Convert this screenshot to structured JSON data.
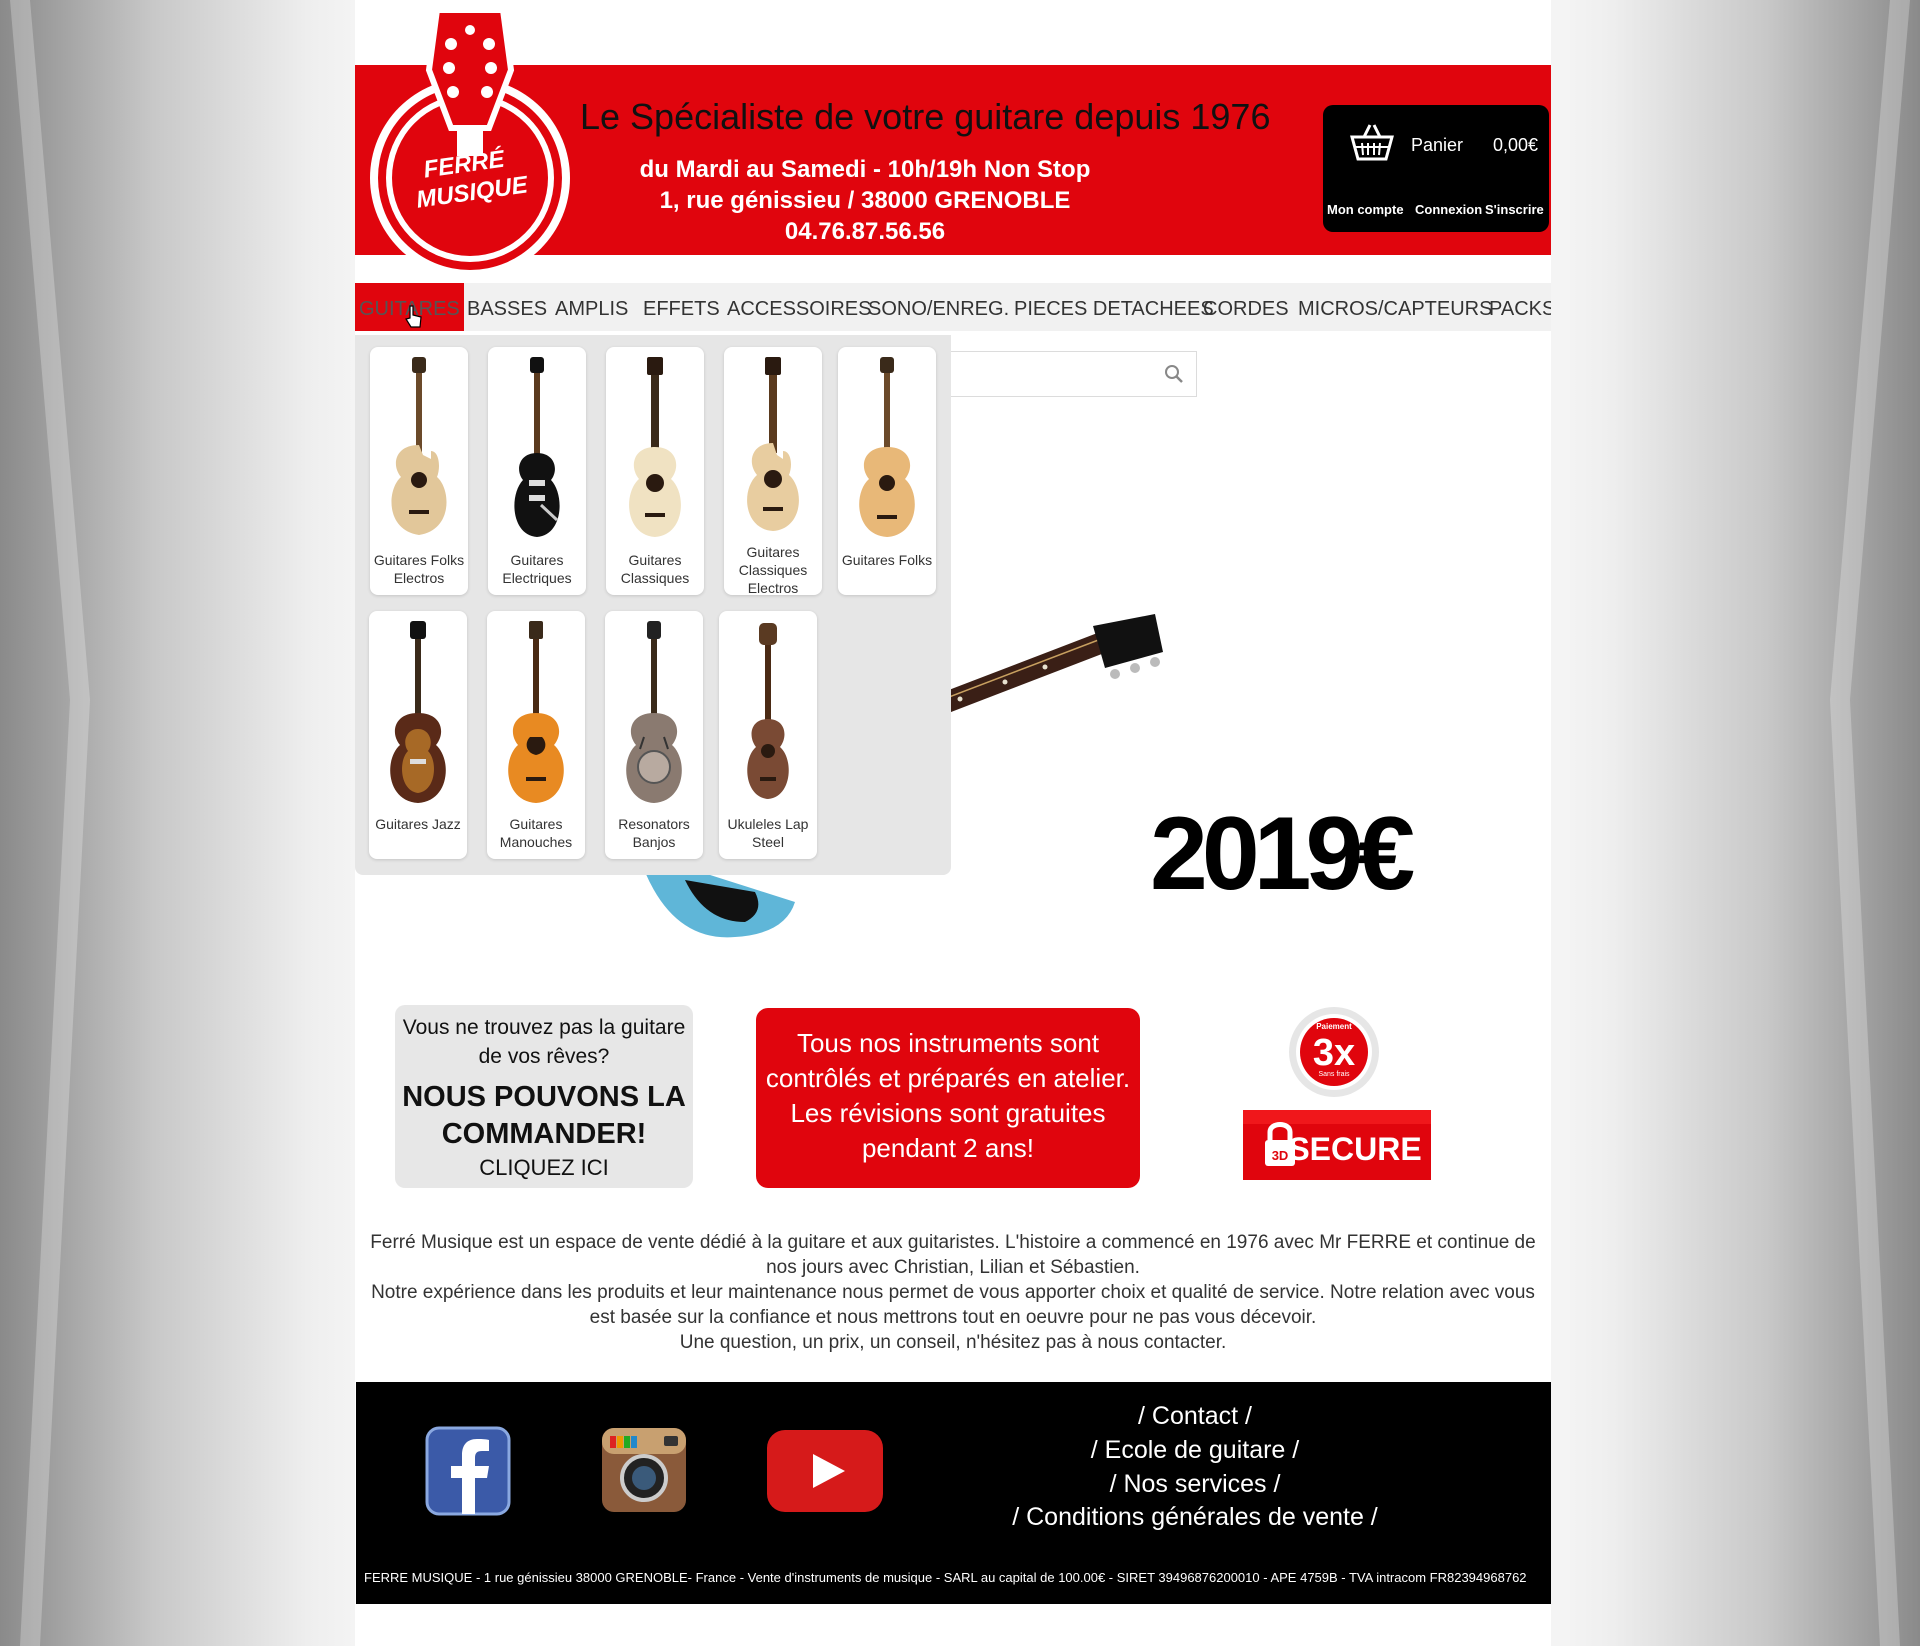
{
  "header": {
    "logo_text": [
      "FERRÉ",
      "MUSIQUE"
    ],
    "tagline": "Le Spécialiste de votre guitare depuis 1976",
    "hours": "du Mardi au Samedi - 10h/19h Non Stop",
    "address": "1, rue génissieu / 38000 GRENOBLE",
    "phone": "04.76.87.56.56"
  },
  "cart": {
    "label": "Panier",
    "total": "0,00€",
    "my_account": "Mon compte",
    "login": "Connexion",
    "register": "S'inscrire"
  },
  "nav": {
    "items": [
      "GUITARES",
      "BASSES",
      "AMPLIS",
      "EFFETS",
      "ACCESSOIRES",
      "SONO/ENREG.",
      "PIECES DETACHEES",
      "CORDES",
      "MICROS/CAPTEURS",
      "PACKS"
    ]
  },
  "dropdown": {
    "categories": [
      {
        "label": "Guitares Folks Electros",
        "icon": "acoustic-cutaway-guitar-icon"
      },
      {
        "label": "Guitares Electriques",
        "icon": "electric-guitar-icon"
      },
      {
        "label": "Guitares Classiques",
        "icon": "classical-guitar-icon"
      },
      {
        "label": "Guitares Classiques Electros",
        "icon": "classical-electro-guitar-icon"
      },
      {
        "label": "Guitares Folks",
        "icon": "folk-guitar-icon"
      },
      {
        "label": "Guitares Jazz",
        "icon": "jazz-guitar-icon"
      },
      {
        "label": "Guitares Manouches",
        "icon": "manouche-guitar-icon"
      },
      {
        "label": "Resonators Banjos",
        "icon": "resonator-guitar-icon"
      },
      {
        "label": "Ukuleles Lap Steel",
        "icon": "ukulele-icon"
      }
    ]
  },
  "banner": {
    "price": "2019€"
  },
  "promo": {
    "custom_order_question": "Vous ne trouvez pas la guitare de vos rêves?",
    "custom_order_headline": "NOUS POUVONS LA COMMANDER!",
    "custom_order_cta": "CLIQUEZ ICI",
    "workshop_text": "Tous nos instruments sont contrôlés et préparés en atelier. Les révisions sont gratuites pendant 2 ans!",
    "payment_badge": {
      "big": "3x",
      "small_top": "Paiement",
      "small_bottom": "Sans frais"
    },
    "secure_badge": {
      "text": "SECURE",
      "prefix": "3D"
    }
  },
  "about": {
    "lines": [
      "Ferré Musique est un espace de vente dédié à la guitare et aux guitaristes. L'histoire a commencé en 1976 avec Mr FERRE et continue de nos jours avec Christian, Lilian et Sébastien.",
      "Notre expérience dans les produits et leur maintenance nous permet de vous apporter choix et qualité de service. Notre relation avec vous est basée sur la confiance et nous mettrons tout en oeuvre pour ne pas vous décevoir.",
      "Une question, un prix, un conseil, n'hésitez pas à nous contacter."
    ]
  },
  "footer": {
    "links": [
      "/ Contact /",
      "/ Ecole de guitare /",
      "/ Nos services /",
      "/ Conditions générales de vente /"
    ],
    "legal": "FERRE MUSIQUE - 1 rue génissieu 38000 GRENOBLE- France - Vente d'instruments de musique - SARL au capital de 100.00€ - SIRET 39496876200010 - APE 4759B - TVA intracom FR82394968762"
  },
  "colors": {
    "brand_red": "#e0050d",
    "black": "#000000"
  }
}
